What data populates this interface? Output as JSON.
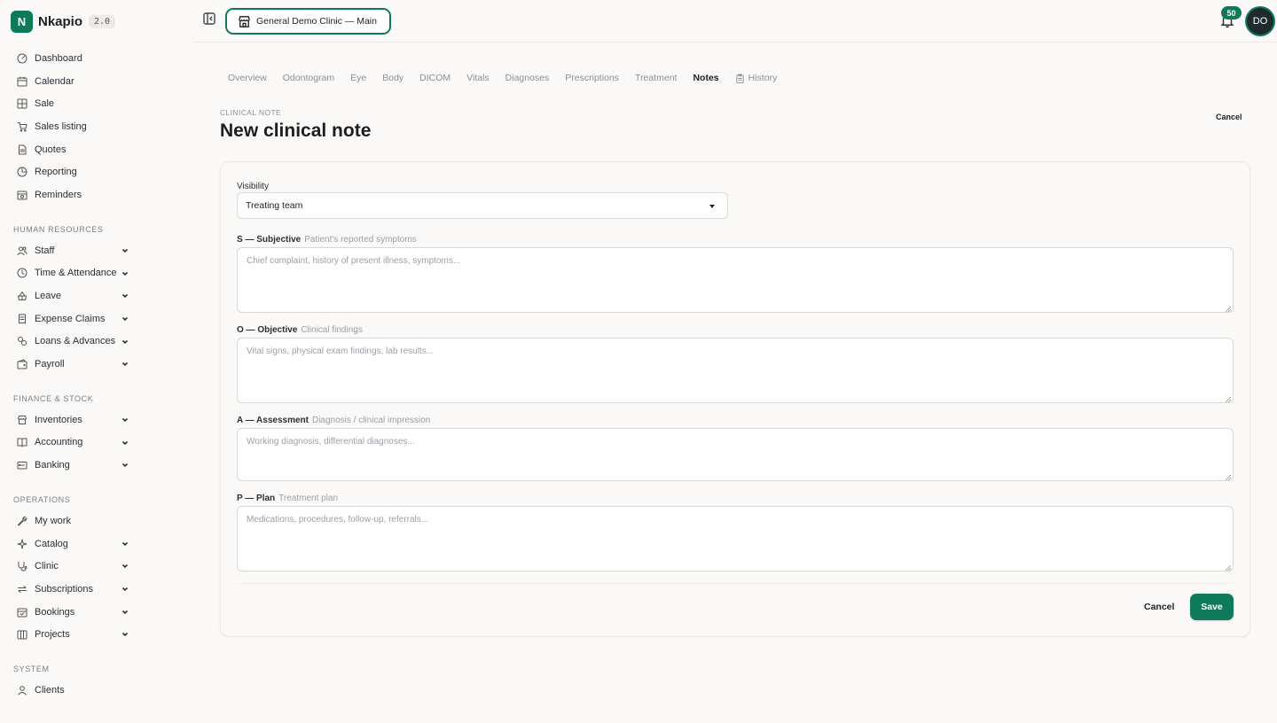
{
  "brand": {
    "name": "Nkapio",
    "logo_letter": "N",
    "version": "2.0",
    "accent": "#0f7a5a"
  },
  "sidebar": {
    "main_items": [
      {
        "label": "Dashboard",
        "icon": "dashboard-icon"
      },
      {
        "label": "Calendar",
        "icon": "calendar-icon"
      },
      {
        "label": "Sale",
        "icon": "pos-icon"
      },
      {
        "label": "Sales listing",
        "icon": "cart-icon"
      },
      {
        "label": "Quotes",
        "icon": "document-icon"
      },
      {
        "label": "Reporting",
        "icon": "chart-icon"
      },
      {
        "label": "Reminders",
        "icon": "reminder-icon"
      }
    ],
    "sections": [
      {
        "title": "HUMAN RESOURCES",
        "items": [
          {
            "label": "Staff",
            "icon": "users-icon",
            "expandable": true
          },
          {
            "label": "Time & Attendance",
            "icon": "clock-icon",
            "expandable": true
          },
          {
            "label": "Leave",
            "icon": "leave-icon",
            "expandable": true
          },
          {
            "label": "Expense Claims",
            "icon": "receipt-icon",
            "expandable": true
          },
          {
            "label": "Loans & Advances",
            "icon": "coins-icon",
            "expandable": true
          },
          {
            "label": "Payroll",
            "icon": "wallet-icon",
            "expandable": true
          }
        ]
      },
      {
        "title": "FINANCE & STOCK",
        "items": [
          {
            "label": "Inventories",
            "icon": "store-icon",
            "expandable": true
          },
          {
            "label": "Accounting",
            "icon": "book-icon",
            "expandable": true
          },
          {
            "label": "Banking",
            "icon": "bank-icon",
            "expandable": true
          }
        ]
      },
      {
        "title": "OPERATIONS",
        "items": [
          {
            "label": "My work",
            "icon": "wrench-icon",
            "expandable": false
          },
          {
            "label": "Catalog",
            "icon": "sparkle-icon",
            "expandable": true
          },
          {
            "label": "Clinic",
            "icon": "stethoscope-icon",
            "expandable": true
          },
          {
            "label": "Subscriptions",
            "icon": "repeat-icon",
            "expandable": true
          },
          {
            "label": "Bookings",
            "icon": "booking-icon",
            "expandable": true
          },
          {
            "label": "Projects",
            "icon": "columns-icon",
            "expandable": true
          }
        ]
      },
      {
        "title": "SYSTEM",
        "items": [
          {
            "label": "Clients",
            "icon": "user-icon",
            "expandable": false
          }
        ]
      }
    ]
  },
  "topbar": {
    "clinic_name": "General Demo Clinic — Main",
    "notification_count": "50",
    "avatar_initials": "DO"
  },
  "tabs": [
    {
      "label": "Overview",
      "active": false
    },
    {
      "label": "Odontogram",
      "active": false
    },
    {
      "label": "Eye",
      "active": false
    },
    {
      "label": "Body",
      "active": false
    },
    {
      "label": "DICOM",
      "active": false
    },
    {
      "label": "Vitals",
      "active": false
    },
    {
      "label": "Diagnoses",
      "active": false
    },
    {
      "label": "Prescriptions",
      "active": false
    },
    {
      "label": "Treatment",
      "active": false
    },
    {
      "label": "Notes",
      "active": true
    },
    {
      "label": "History",
      "active": false,
      "icon": "clipboard-icon"
    }
  ],
  "page": {
    "eyebrow": "CLINICAL NOTE",
    "title": "New clinical note",
    "cancel_label": "Cancel"
  },
  "form": {
    "visibility_label": "Visibility",
    "visibility_value": "Treating team",
    "subjective": {
      "label": "S — Subjective",
      "hint": "Patient's reported symptoms",
      "placeholder": "Chief complaint, history of present illness, symptoms..."
    },
    "objective": {
      "label": "O — Objective",
      "hint": "Clinical findings",
      "placeholder": "Vital signs, physical exam findings, lab results..."
    },
    "assessment": {
      "label": "A — Assessment",
      "hint": "Diagnosis / clinical impression",
      "placeholder": "Working diagnosis, differential diagnoses..."
    },
    "plan": {
      "label": "P — Plan",
      "hint": "Treatment plan",
      "placeholder": "Medications, procedures, follow-up, referrals..."
    },
    "cancel_label": "Cancel",
    "save_label": "Save"
  }
}
